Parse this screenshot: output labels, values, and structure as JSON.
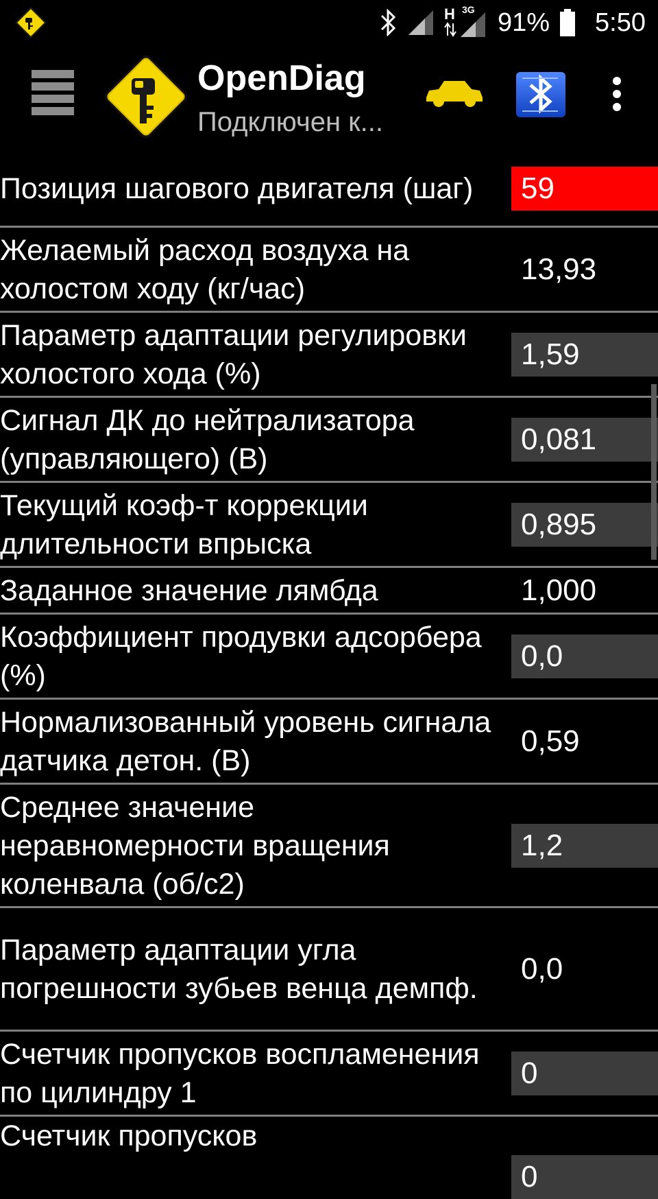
{
  "status_bar": {
    "network_h": "H",
    "network_3g": "3G",
    "battery": "91%",
    "time": "5:50",
    "icons": [
      "opendiag-notification-icon",
      "bluetooth-icon",
      "signal-icon",
      "mobile-data-icon",
      "battery-icon"
    ]
  },
  "action_bar": {
    "title": "OpenDiag",
    "subtitle": "Подключен к...",
    "icons": [
      "menu-icon",
      "opendiag-logo-icon",
      "car-icon",
      "elm327-bluetooth-icon",
      "overflow-menu-icon"
    ]
  },
  "colors": {
    "value_box": "#3c3c3c",
    "value_alert": "#ff0000",
    "divider": "#7f7f7f",
    "logo_yellow": "#f5d800"
  },
  "params": [
    {
      "label": "Позиция шагового двигателя (шаг)",
      "value": "59",
      "style": "red"
    },
    {
      "label": "Желаемый расход воздуха на холостом ходу (кг/час)",
      "value": "13,93",
      "style": "none"
    },
    {
      "label": "Параметр адаптации регулировки холостого хода (%)",
      "value": "1,59",
      "style": "box"
    },
    {
      "label": "Сигнал ДК до нейтрализатора (управляющего) (В)",
      "value": "0,081",
      "style": "box"
    },
    {
      "label": "Текущий коэф-т коррекции длительности впрыска",
      "value": "0,895",
      "style": "box"
    },
    {
      "label": "Заданное значение лямбда",
      "value": "1,000",
      "style": "none"
    },
    {
      "label": "Коэффициент продувки адсорбера (%)",
      "value": "0,0",
      "style": "box"
    },
    {
      "label": "Нормализованный уровень сигнала датчика детон. (В)",
      "value": "0,59",
      "style": "none"
    },
    {
      "label": "Среднее значение неравномерности вращения коленвала (об/с2)",
      "value": "1,2",
      "style": "box"
    },
    {
      "label": "Параметр адаптации угла погрешности зубьев венца демпф.",
      "value": "0,0",
      "style": "none"
    },
    {
      "label": "Счетчик пропусков воспламенения по цилиндру 1",
      "value": "0",
      "style": "box"
    },
    {
      "label": "Счетчик пропусков",
      "value": "0",
      "style": "box"
    }
  ]
}
